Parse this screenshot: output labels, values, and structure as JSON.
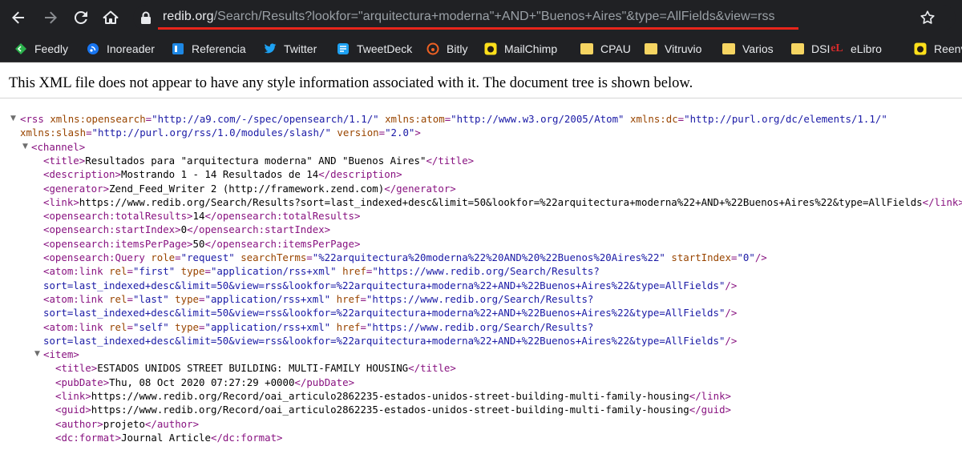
{
  "toolbar": {
    "url_domain": "redib.org",
    "url_path": "/Search/Results?lookfor=\"arquitectura+moderna\"+AND+\"Buenos+Aires\"&type=AllFields&view=rss"
  },
  "bookmarks": [
    {
      "label": "Feedly",
      "icon": "feedly-icon",
      "color": "#2bb24c"
    },
    {
      "label": "Inoreader",
      "icon": "inoreader-icon",
      "color": "#1875f0"
    },
    {
      "label": "Referencia",
      "icon": "referencia-icon",
      "color": "#1e88e5"
    },
    {
      "label": "Twitter",
      "icon": "twitter-icon",
      "color": "#1da1f2"
    },
    {
      "label": "TweetDeck",
      "icon": "tweetdeck-icon",
      "color": "#1da1f2"
    },
    {
      "label": "Bitly",
      "icon": "bitly-icon",
      "color": "#ee6123"
    },
    {
      "label": "MailChimp",
      "icon": "mailchimp-icon",
      "color": "#ffe01b"
    },
    {
      "label": "CPAU",
      "icon": "folder-icon",
      "color": "#f6d562"
    },
    {
      "label": "Vitruvio",
      "icon": "folder-icon",
      "color": "#f6d562"
    },
    {
      "label": "Varios",
      "icon": "folder-icon",
      "color": "#f6d562"
    },
    {
      "label": "DSI",
      "icon": "folder-icon",
      "color": "#f6d562"
    },
    {
      "label": "eLibro",
      "icon": "elibro-icon",
      "color": "#d62b2b"
    },
    {
      "label": "Reenvi",
      "icon": "mailchimp-icon",
      "color": "#ffe01b"
    }
  ],
  "notice": "This XML file does not appear to have any style information associated with it. The document tree is shown below.",
  "xml_lines": [
    "<rss xmlns:opensearch=\"http://a9.com/-/spec/opensearch/1.1/\" xmlns:atom=\"http://www.w3.org/2005/Atom\" xmlns:dc=\"http://purl.org/dc/elements/1.1/\"",
    "xmlns:slash=\"http://purl.org/rss/1.0/modules/slash/\" version=\"2.0\">",
    "<channel>",
    "<title>Resultados para \"arquitectura moderna\" AND \"Buenos Aires\"</title>",
    "<description>Mostrando 1 - 14 Resultados de 14</description>",
    "<generator>Zend_Feed_Writer 2 (http://framework.zend.com)</generator>",
    "<link>https://www.redib.org/Search/Results?sort=last_indexed+desc&limit=50&lookfor=%22arquitectura+moderna%22+AND+%22Buenos+Aires%22&type=AllFields</link>",
    "<opensearch:totalResults>14</opensearch:totalResults>",
    "<opensearch:startIndex>0</opensearch:startIndex>",
    "<opensearch:itemsPerPage>50</opensearch:itemsPerPage>",
    "<opensearch:Query role=\"request\" searchTerms=\"%22arquitectura%20moderna%22%20AND%20%22Buenos%20Aires%22\" startIndex=\"0\"/>",
    "<atom:link rel=\"first\" type=\"application/rss+xml\" href=\"https://www.redib.org/Search/Results?",
    "sort=last_indexed+desc&limit=50&view=rss&lookfor=%22arquitectura+moderna%22+AND+%22Buenos+Aires%22&type=AllFields\"/>",
    "<atom:link rel=\"last\" type=\"application/rss+xml\" href=\"https://www.redib.org/Search/Results?",
    "sort=last_indexed+desc&limit=50&view=rss&lookfor=%22arquitectura+moderna%22+AND+%22Buenos+Aires%22&type=AllFields\"/>",
    "<atom:link rel=\"self\" type=\"application/rss+xml\" href=\"https://www.redib.org/Search/Results?",
    "sort=last_indexed+desc&limit=50&view=rss&lookfor=%22arquitectura+moderna%22+AND+%22Buenos+Aires%22&type=AllFields\"/>",
    "<item>",
    "<title>ESTADOS UNIDOS STREET BUILDING: MULTI-FAMILY HOUSING</title>",
    "<pubDate>Thu, 08 Oct 2020 07:27:29 +0000</pubDate>",
    "<link>https://www.redib.org/Record/oai_articulo2862235-estados-unidos-street-building-multi-family-housing</link>",
    "<guid>https://www.redib.org/Record/oai_articulo2862235-estados-unidos-street-building-multi-family-housing</guid>",
    "<author>projeto</author>",
    "<dc:format>Journal Article</dc:format>"
  ],
  "collapse_arrow": "▼"
}
